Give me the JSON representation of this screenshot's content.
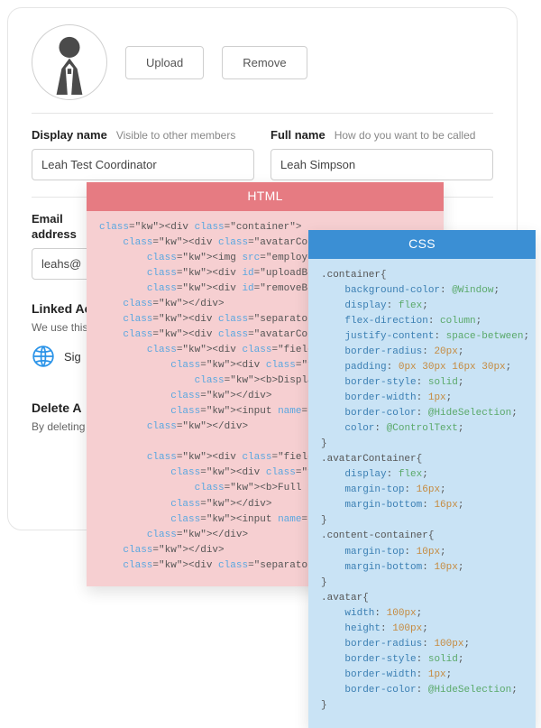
{
  "avatar": {
    "upload_label": "Upload",
    "remove_label": "Remove"
  },
  "fields": {
    "display_name": {
      "label": "Display name",
      "hint": "Visible to other members",
      "value": "Leah Test Coordinator"
    },
    "full_name": {
      "label": "Full name",
      "hint": "How do you want to be called",
      "value": "Leah Simpson"
    },
    "email": {
      "label": "Email address",
      "value": "leahs@"
    }
  },
  "linked": {
    "title": "Linked Ac",
    "sub": "We use this",
    "item_label_prefix": "Sig"
  },
  "delete": {
    "title": "Delete A",
    "sub": "By deleting your account you will lose all data"
  },
  "overlays": {
    "html": {
      "title": "HTML"
    },
    "css": {
      "title": "CSS"
    }
  },
  "html_code_lines": [
    "<div class=\"container\">",
    "    <div class=\"avatarContainer\">",
    "        <img src=\"employee\" class=\"avatar\"/>",
    "        <div id=\"uploadBtn\" class=\"centered",
    "        <div id=\"removeBtn\" class=\"centered",
    "    </div>",
    "    <div class=\"separator\"></div>",
    "    <div class=\"avatarContainer spacebetwee",
    "        <div class=\"field-container\">",
    "            <div class=\"field-header\">",
    "                <b>Display name</b><b class",
    "            </div>",
    "            <input name=\"textEditDisplayNam",
    "        </div>",
    "",
    "        <div class=\"field-container with-le",
    "            <div class=\"field-header\">",
    "                <b>Full name</b><b class=\"he",
    "            </div>",
    "            <input name=\"textEditFullName\"",
    "        </div>",
    "    </div>",
    "    <div class=\"separator\"></div>"
  ],
  "css_code": {
    "rules": [
      {
        "selector": ".container",
        "decls": [
          {
            "prop": "background-color",
            "val": "@Window",
            "type": "val"
          },
          {
            "prop": "display",
            "val": "flex",
            "type": "val"
          },
          {
            "prop": "flex-direction",
            "val": "column",
            "type": "val"
          },
          {
            "prop": "justify-content",
            "val": "space-between",
            "type": "val"
          },
          {
            "prop": "border-radius",
            "val": "20px",
            "type": "num"
          },
          {
            "prop": "padding",
            "val": "0px 30px 16px 30px",
            "type": "num"
          },
          {
            "prop": "border-style",
            "val": "solid",
            "type": "val"
          },
          {
            "prop": "border-width",
            "val": "1px",
            "type": "num"
          },
          {
            "prop": "border-color",
            "val": "@HideSelection",
            "type": "val"
          },
          {
            "prop": "color",
            "val": "@ControlText",
            "type": "val"
          }
        ]
      },
      {
        "selector": ".avatarContainer",
        "decls": [
          {
            "prop": "display",
            "val": "flex",
            "type": "val"
          },
          {
            "prop": "margin-top",
            "val": "16px",
            "type": "num"
          },
          {
            "prop": "margin-bottom",
            "val": "16px",
            "type": "num"
          }
        ]
      },
      {
        "selector": ".content-container",
        "decls": [
          {
            "prop": "margin-top",
            "val": "10px",
            "type": "num"
          },
          {
            "prop": "margin-bottom",
            "val": "10px",
            "type": "num"
          }
        ]
      },
      {
        "selector": ".avatar",
        "decls": [
          {
            "prop": "width",
            "val": "100px",
            "type": "num"
          },
          {
            "prop": "height",
            "val": "100px",
            "type": "num"
          },
          {
            "prop": "border-radius",
            "val": "100px",
            "type": "num"
          },
          {
            "prop": "border-style",
            "val": "solid",
            "type": "val"
          },
          {
            "prop": "border-width",
            "val": "1px",
            "type": "num"
          },
          {
            "prop": "border-color",
            "val": "@HideSelection",
            "type": "val"
          }
        ]
      }
    ]
  }
}
